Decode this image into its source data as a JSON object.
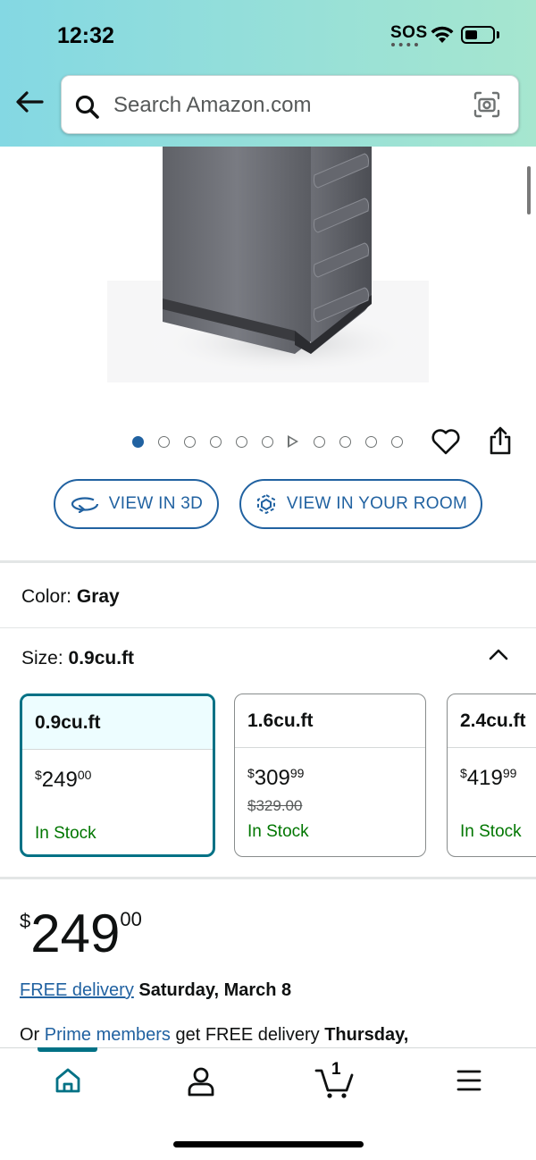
{
  "status_bar": {
    "time": "12:32",
    "sos": "SOS"
  },
  "search": {
    "placeholder": "Search Amazon.com"
  },
  "gallery": {
    "dot_count": 11,
    "active_index": 0
  },
  "buttons": {
    "view_3d": "VIEW IN 3D",
    "view_room": "VIEW IN YOUR ROOM"
  },
  "color": {
    "label": "Color:",
    "value": "Gray"
  },
  "size": {
    "label": "Size:",
    "value": "0.9cu.ft",
    "options": [
      {
        "name": "0.9cu.ft",
        "price_symbol": "$",
        "price_whole": "249",
        "price_cents": "00",
        "list_price": "",
        "stock": "In Stock"
      },
      {
        "name": "1.6cu.ft",
        "price_symbol": "$",
        "price_whole": "309",
        "price_cents": "99",
        "list_price": "$329.00",
        "stock": "In Stock"
      },
      {
        "name": "2.4cu.ft",
        "price_symbol": "$",
        "price_whole": "419",
        "price_cents": "99",
        "list_price": "",
        "stock": "In Stock"
      }
    ]
  },
  "price": {
    "symbol": "$",
    "whole": "249",
    "cents": "00"
  },
  "delivery": {
    "link": "FREE delivery",
    "date": "Saturday, March 8"
  },
  "prime": {
    "prefix": "Or",
    "link": "Prime members",
    "text": "get FREE delivery",
    "date": "Thursday,"
  },
  "bottom_nav": {
    "cart_count": "1"
  },
  "colors": {
    "accent": "#007185",
    "link": "#2162a1",
    "in_stock": "#007600"
  }
}
